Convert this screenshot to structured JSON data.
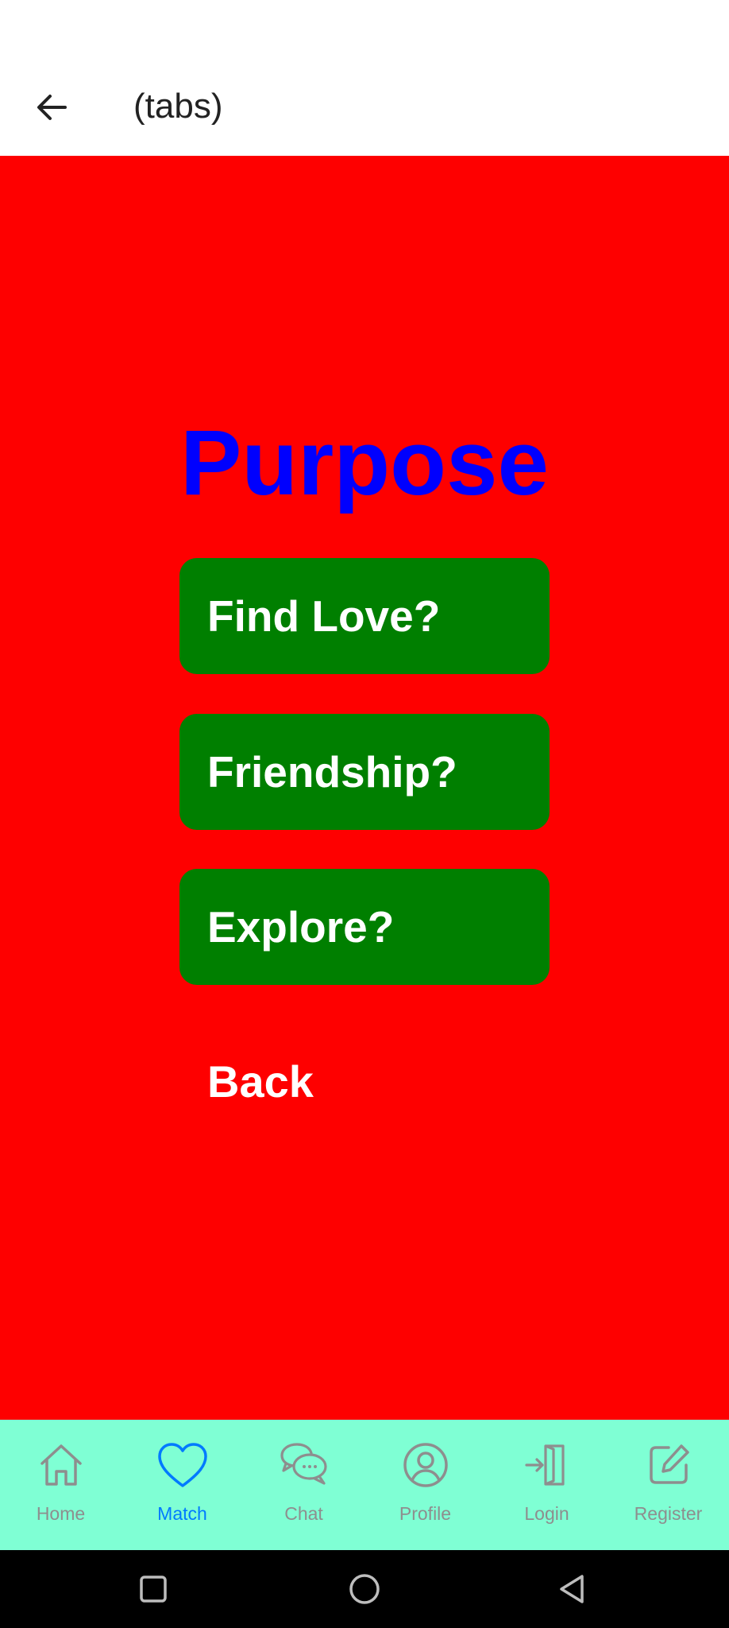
{
  "header": {
    "title": "(tabs)"
  },
  "main": {
    "title": "Purpose",
    "options": [
      {
        "label": "Find Love?"
      },
      {
        "label": "Friendship?"
      },
      {
        "label": "Explore?"
      }
    ],
    "back_label": "Back"
  },
  "tabs": [
    {
      "label": "Home",
      "icon": "home-icon",
      "active": false
    },
    {
      "label": "Match",
      "icon": "heart-icon",
      "active": true
    },
    {
      "label": "Chat",
      "icon": "chat-bubbles-icon",
      "active": false
    },
    {
      "label": "Profile",
      "icon": "user-circle-icon",
      "active": false
    },
    {
      "label": "Login",
      "icon": "login-door-icon",
      "active": false
    },
    {
      "label": "Register",
      "icon": "edit-icon",
      "active": false
    }
  ],
  "colors": {
    "content_background": "#fe0000",
    "title_color": "#0000fe",
    "button_background": "#007f00",
    "tab_bar_background": "#7fffd4",
    "tab_active": "#007aff",
    "tab_inactive": "#8e8e8e"
  }
}
